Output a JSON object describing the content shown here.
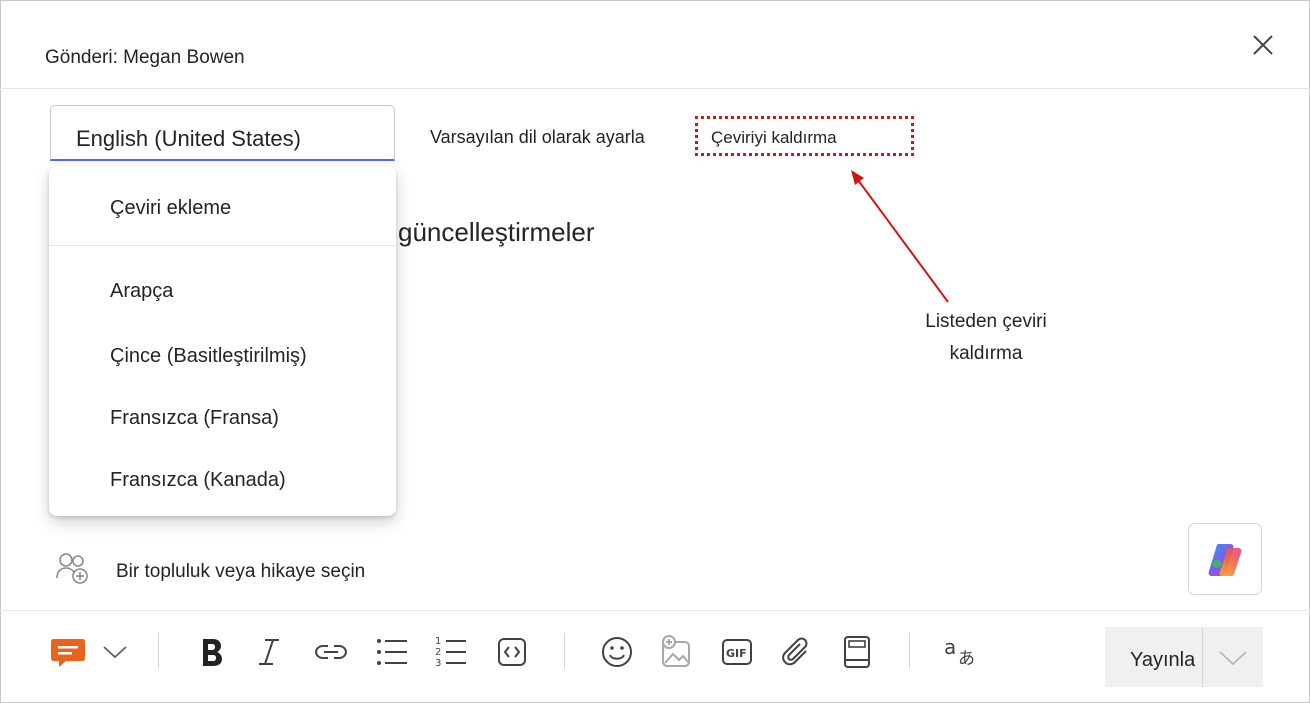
{
  "header": {
    "title": "Gönderi: Megan Bowen"
  },
  "language": {
    "selected": "English (United States)",
    "set_default_label": "Varsayılan dil olarak ayarla",
    "remove_translation_label": "Çeviriyi kaldırma"
  },
  "dropdown": {
    "add_translation": "Çeviri ekleme",
    "options": [
      "Arapça",
      "Çince (Basitleştirilmiş)",
      "Fransızca (Fransa)",
      "Fransızca (Kanada)"
    ]
  },
  "body": {
    "heading_partial": "güncelleştirmeler"
  },
  "callout": {
    "line1": "Listeden çeviri",
    "line2": "kaldırma"
  },
  "community": {
    "label": "Bir topluluk veya hikaye seçin"
  },
  "toolbar": {
    "publish_label": "Yayınla",
    "icons": [
      "post-type-icon",
      "chevron-down-icon",
      "bold-icon",
      "italic-icon",
      "link-icon",
      "bullet-list-icon",
      "numbered-list-icon",
      "code-icon",
      "emoji-icon",
      "add-image-icon",
      "gif-icon",
      "attach-icon",
      "book-icon",
      "translate-icon"
    ]
  },
  "colors": {
    "accent": "#4f6bed",
    "annotation_red": "#d01515",
    "post_type_orange": "#e8631c"
  }
}
